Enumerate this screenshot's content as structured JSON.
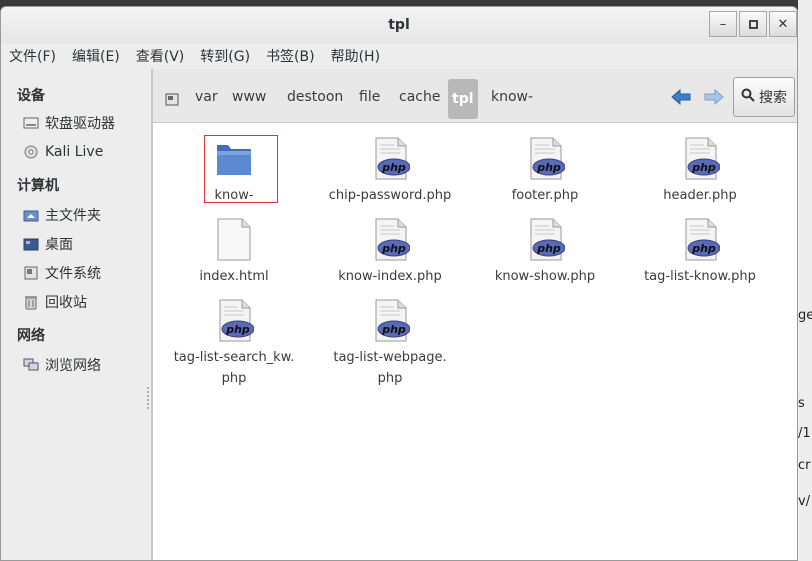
{
  "window": {
    "title": "tpl",
    "buttons": [
      "minimize",
      "maximize",
      "close"
    ]
  },
  "menu": [
    "文件(F)",
    "编辑(E)",
    "查看(V)",
    "转到(G)",
    "书签(B)",
    "帮助(H)"
  ],
  "sidebar": {
    "devices_title": "设备",
    "devices": [
      {
        "label": "软盘驱动器",
        "icon": "floppy-drive-icon"
      },
      {
        "label": "Kali Live",
        "icon": "optical-disc-icon"
      }
    ],
    "computer_title": "计算机",
    "computer": [
      {
        "label": "主文件夹",
        "icon": "home-folder-icon"
      },
      {
        "label": "桌面",
        "icon": "desktop-icon"
      },
      {
        "label": "文件系统",
        "icon": "filesystem-icon"
      },
      {
        "label": "回收站",
        "icon": "trash-icon"
      }
    ],
    "network_title": "网络",
    "network": [
      {
        "label": "浏览网络",
        "icon": "network-icon"
      }
    ]
  },
  "pathbar": {
    "crumbs": [
      "var",
      "www",
      "destoon",
      "file",
      "cache"
    ],
    "active": "tpl",
    "after": "know-",
    "search_label": "搜索"
  },
  "files": [
    {
      "name": "know-",
      "type": "folder",
      "selected": true
    },
    {
      "name": "chip-password.php",
      "type": "php"
    },
    {
      "name": "footer.php",
      "type": "php"
    },
    {
      "name": "header.php",
      "type": "php"
    },
    {
      "name": "index.html",
      "type": "html"
    },
    {
      "name": "know-index.php",
      "type": "php"
    },
    {
      "name": "know-show.php",
      "type": "php"
    },
    {
      "name": "tag-list-know.php",
      "type": "php"
    },
    {
      "name": "tag-list-search_kw.",
      "name2": "php",
      "type": "php"
    },
    {
      "name": "tag-list-webpage.",
      "name2": "php",
      "type": "php"
    }
  ],
  "background_fragments": [
    "ge",
    "s",
    "/1",
    "cr",
    "v/"
  ],
  "colors": {
    "selection_border": "#e03030",
    "folder_blue": "#4a7fc8",
    "php_badge": "#5a6ab8"
  }
}
